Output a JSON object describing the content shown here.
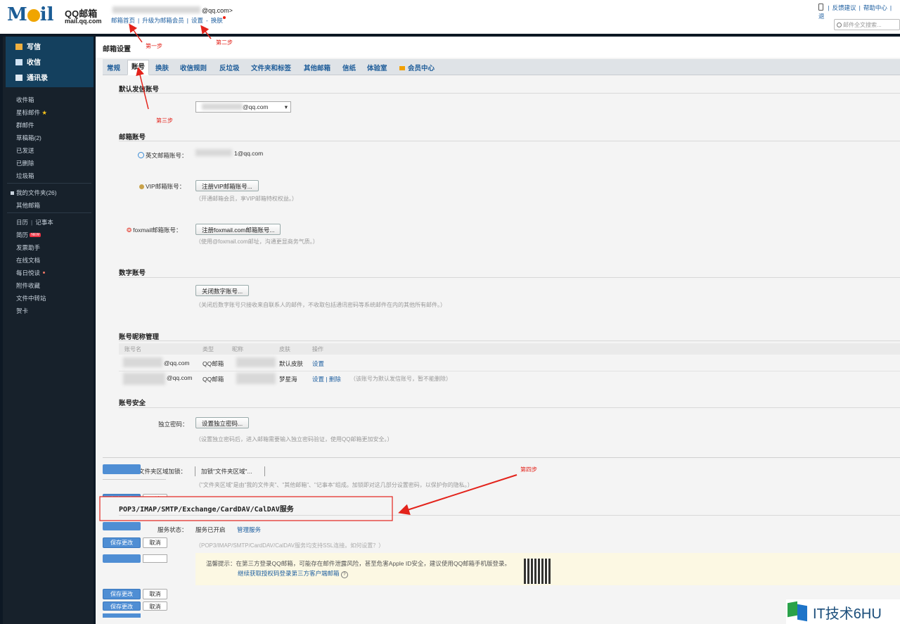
{
  "top": {
    "brand_cn": "QQ邮箱",
    "brand_domain": "mail.qq.com",
    "account_suffix": "@qq.com>",
    "links": [
      "邮箱首页",
      "升级为邮箱会员",
      "设置",
      "换肤"
    ],
    "right_links": [
      "反馈建议",
      "帮助中心",
      "退"
    ],
    "search_placeholder": "邮件全文搜索..."
  },
  "sidebar": {
    "compose": "写信",
    "inbox": "收信",
    "contacts": "通讯录",
    "folders": [
      "收件箱",
      "星标邮件",
      "群邮件",
      "草稿箱(2)",
      "已发送",
      "已删除",
      "垃圾箱"
    ],
    "my_folders": "我的文件夹(26)",
    "other_mail": "其他邮箱",
    "calendar": "日历",
    "notes": "记事本",
    "resume": "简历",
    "new_badge": "NEW",
    "apps": [
      "发票助手",
      "在线文档",
      "每日悦读",
      "附件收藏",
      "文件中转站",
      "贺卡"
    ]
  },
  "settings": {
    "title": "邮箱设置",
    "tabs": [
      "常规",
      "账号",
      "换肤",
      "收信规则",
      "反垃圾",
      "文件夹和标签",
      "其他邮箱",
      "信纸",
      "体验室",
      "会员中心"
    ],
    "default_sender_title": "默认发信账号",
    "default_sender_value": "@qq.com",
    "mailbox_accounts_title": "邮箱账号",
    "english_account_label": "英文邮箱账号：",
    "english_account_value": "1@qq.com",
    "vip_label": "VIP邮箱账号：",
    "vip_button": "注册VIP邮箱账号...",
    "vip_hint": "（开通邮箱会员，享VIP邮箱特权权益。）",
    "foxmail_label": "foxmail邮箱账号：",
    "foxmail_button": "注册foxmail.com邮箱账号...",
    "foxmail_hint": "（使用@foxmail.com邮址，沟通更显商务气质。）",
    "digital_title": "数字账号",
    "digital_button": "关闭数字账号...",
    "digital_hint": "（关闭后数字账号只接收来自联系人的邮件，不收取包括通讯密码等系统邮件在内的其他所有邮件。）",
    "nickname_title": "账号昵称管理",
    "nickname_headers": [
      "账号名",
      "类型",
      "昵称",
      "皮肤",
      "操作"
    ],
    "nickname_rows": [
      {
        "account": "@qq.com",
        "type": "QQ邮箱",
        "skin": "默认皮肤",
        "action": "设置",
        "note": ""
      },
      {
        "account": "@qq.com",
        "type": "QQ邮箱",
        "skin": "梦星海",
        "action": "设置 | 删除",
        "note": "（该账号为默认发信账号，暂不能删除）"
      }
    ],
    "security_title": "账号安全",
    "independent_pw_label": "独立密码：",
    "independent_pw_button": "设置独立密码...",
    "independent_pw_hint": "（设置独立密码后，进入邮箱需要输入独立密码验证，使用QQ邮箱更加安全。）",
    "folder_lock_label": "文件夹区域加锁：",
    "folder_lock_button": "加锁\"文件夹区域\"...",
    "folder_lock_hint": "（\"文件夹区域\"是由\"我的文件夹\"、\"其他邮箱\"、\"记事本\"组成。加锁即对这几部分设置密码，以保护你的隐私。）",
    "service_title": "POP3/IMAP/SMTP/Exchange/CardDAV/CalDAV服务",
    "service_status_label": "服务状态：",
    "service_status_value": "服务已开启",
    "service_manage": "管理服务",
    "service_hint": "（POP3/IMAP/SMTP/CardDAV/CalDAV服务均支持SSL连接。如何设置？）",
    "tip_line1": "温馨提示：在第三方登录QQ邮箱，可能存在邮件泄露风险，甚至危害Apple ID安全，建议使用QQ邮箱手机版登录。",
    "tip_line2": "继续获取授权码登录第三方客户端邮箱",
    "save": "保存更改",
    "cancel": "取消"
  },
  "annotations": {
    "step1": "第一步",
    "step2": "第二步",
    "step3": "第三步",
    "step4": "第四步"
  },
  "watermark": "IT技术6HU",
  "colors": {
    "accent_red": "#e3231b",
    "link_blue": "#1e5fa0",
    "save_blue": "#4f8ed4"
  }
}
